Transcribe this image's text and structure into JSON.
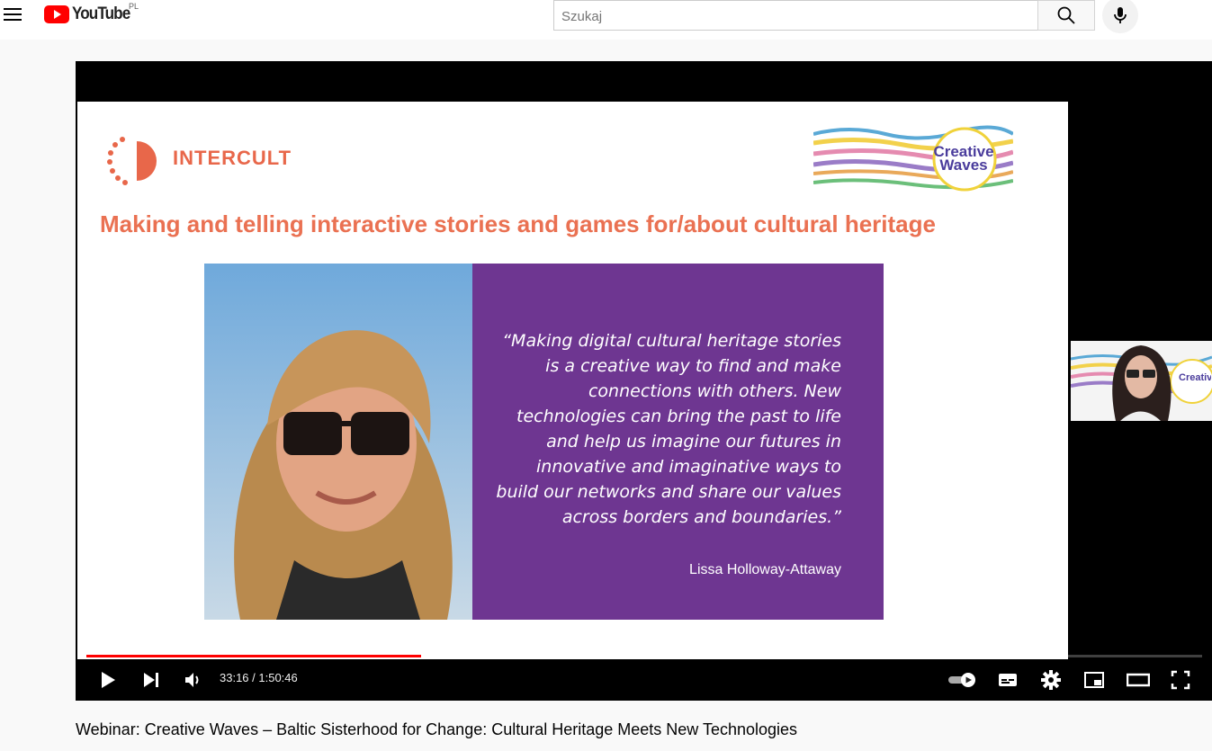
{
  "header": {
    "logo_text": "YouTube",
    "country_code": "PL",
    "search_placeholder": "Szukaj"
  },
  "icons": {
    "menu": "hamburger-icon",
    "search": "search-icon",
    "mic": "mic-icon",
    "play": "play-icon",
    "next": "next-icon",
    "volume": "volume-icon",
    "autoplay": "autoplay-toggle-icon",
    "subtitles": "subtitles-icon",
    "settings": "gear-icon",
    "miniplayer": "miniplayer-icon",
    "theater": "theater-icon",
    "fullscreen": "fullscreen-icon"
  },
  "slide": {
    "intercult_label": "INTERCULT",
    "creative_waves_label": "Creative Waves",
    "title": "Making and telling interactive stories and games for/about cultural heritage",
    "quote": "“Making digital cultural heritage stories is a creative way to find and make connections with others. New technologies can bring the past to life and help us imagine our futures in innovative and imaginative ways to build our networks and share our values across borders and boundaries.”",
    "quote_author": "Lissa Holloway-Attaway",
    "pip_label": "Creative Waves"
  },
  "player": {
    "current_time": "33:16",
    "duration": "1:50:46",
    "time_display": "33:16 / 1:50:46",
    "progress_fraction": 0.3,
    "buffered_fraction": 0.31
  },
  "video": {
    "title": "Webinar: Creative Waves – Baltic Sisterhood for Change: Cultural Heritage Meets New Technologies"
  },
  "colors": {
    "brand_red": "#ff0000",
    "slide_title": "#ea7152",
    "quote_panel": "#6e3691",
    "intercult_orange": "#e8674a"
  }
}
